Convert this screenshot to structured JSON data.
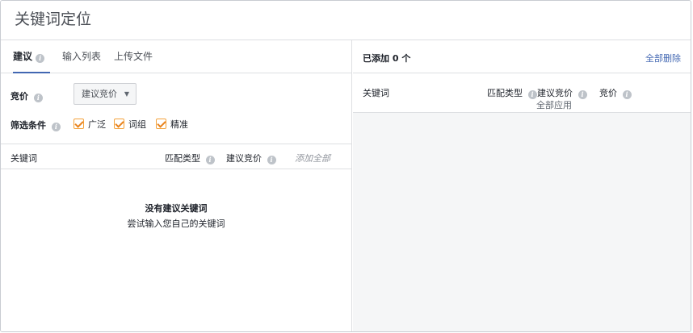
{
  "page": {
    "title": "关键词定位"
  },
  "tabs": [
    {
      "label": "建议",
      "active": true
    },
    {
      "label": "输入列表",
      "active": false
    },
    {
      "label": "上传文件",
      "active": false
    }
  ],
  "bid": {
    "label": "竞价",
    "selected": "建议竞价"
  },
  "filters": {
    "label": "筛选条件",
    "options": [
      {
        "label": "广泛",
        "checked": true
      },
      {
        "label": "词组",
        "checked": true
      },
      {
        "label": "精准",
        "checked": true
      }
    ]
  },
  "left_table": {
    "columns": {
      "keyword": "关键词",
      "match_type": "匹配类型",
      "suggested_bid": "建议竞价",
      "add_all": "添加全部"
    },
    "empty_title": "没有建议关键词",
    "empty_subtitle": "尝试输入您自己的关键词"
  },
  "right_panel": {
    "added_count": "已添加 0 个",
    "delete_all": "全部删除",
    "columns": {
      "keyword": "关键词",
      "match_type": "匹配类型",
      "suggested_bid": "建议竞价",
      "apply_all": "全部应用",
      "bid": "竞价"
    }
  },
  "colors": {
    "accent": "#4267b2",
    "checkbox": "#e8841f"
  },
  "icons": {
    "info": "info-icon",
    "dropdown": "chevron-down-icon",
    "check": "checkbox-checked-icon"
  }
}
